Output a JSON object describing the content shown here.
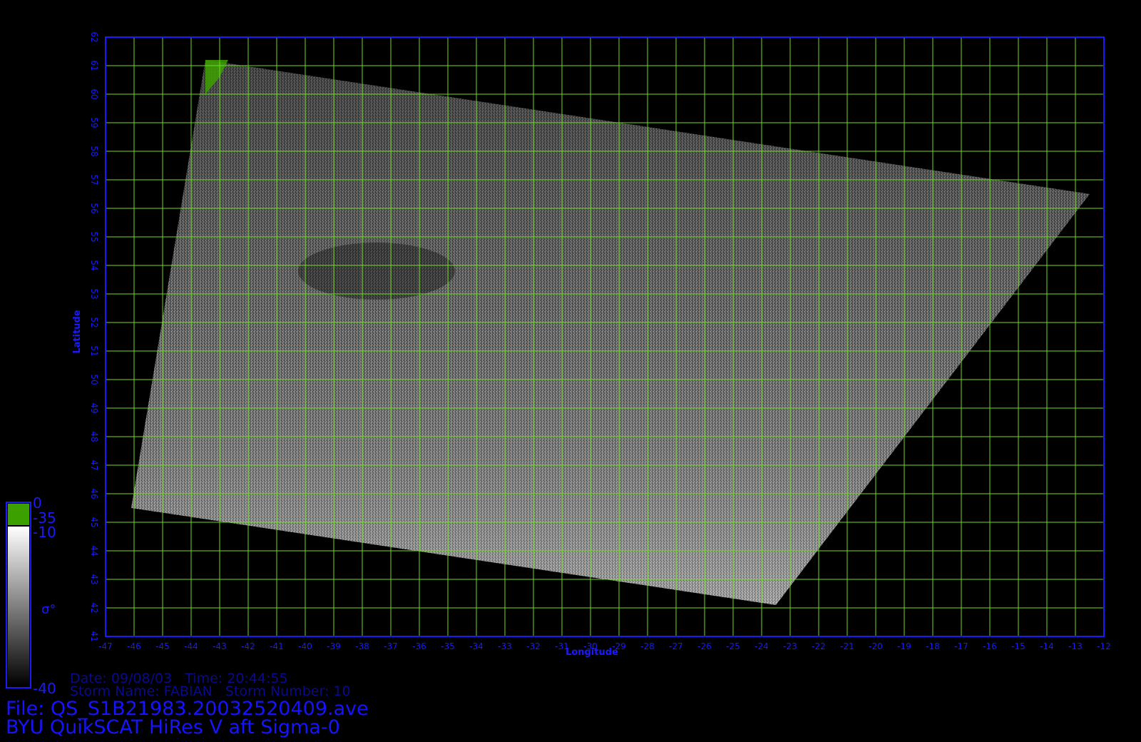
{
  "map": {
    "x_axis": {
      "label": "Longitude",
      "min": -47,
      "max": -12,
      "step": 1
    },
    "y_axis": {
      "label": "Latitude",
      "min": 41,
      "max": 62,
      "step": 1
    },
    "grid_color": "#66dd22",
    "axis_color": "#1a1aff",
    "swath_corners": [
      [
        -43.5,
        61.2
      ],
      [
        -12.5,
        56.5
      ],
      [
        -23.5,
        42.1
      ],
      [
        -46.1,
        45.5
      ]
    ]
  },
  "colorbar": {
    "labels": [
      "0",
      "-35",
      "-10",
      "-40"
    ],
    "symbol": "σ°",
    "land_color": "#3ca000",
    "gradient": [
      "#ffffff",
      "#000000"
    ]
  },
  "info": {
    "date_line": "Date: 09/08/03   Time: 20:44:55",
    "storm_line": "Storm Name: FABIAN   Storm Number: 10",
    "file_line": "File: QS_S1B21983.20032520409.ave",
    "product_line": "BYU QuikSCAT HiRes V aft Sigma-0"
  }
}
